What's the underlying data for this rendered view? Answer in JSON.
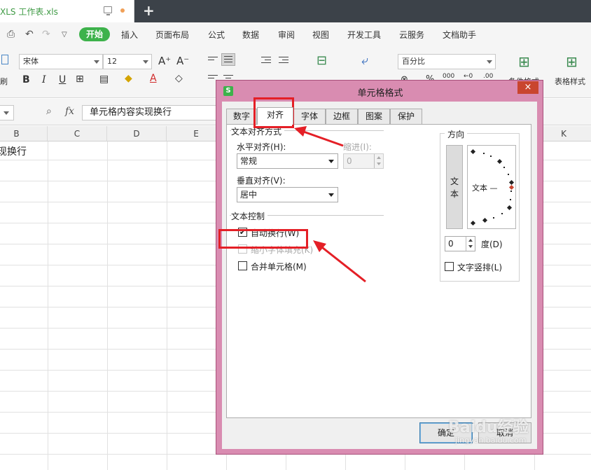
{
  "titlebar": {
    "doc_title": "XLS 工作表.xls",
    "new_tab": "+"
  },
  "menubar": {
    "items": [
      "开始",
      "插入",
      "页面布局",
      "公式",
      "数据",
      "审阅",
      "视图",
      "开发工具",
      "云服务",
      "文档助手"
    ]
  },
  "ribbon": {
    "font_name": "宋体",
    "font_size": "12",
    "number_format": "百分比",
    "grow_font": "A⁺",
    "shrink_font": "A⁻",
    "merge_label": "合并居中",
    "wrap_label": "自动换行",
    "cond_format_label": "条件格式",
    "table_style_label": "表格样式",
    "left_edge_label": "刷",
    "percent": "%",
    "thousand": "000",
    "dec_inc": "←0",
    "dec_dec": ".00"
  },
  "formulabar": {
    "fx_icon": "fx",
    "content": "单元格内容实现换行"
  },
  "sheet": {
    "columns": [
      "B",
      "C",
      "D",
      "E",
      "K"
    ],
    "cell_b1": "现换行"
  },
  "dialog": {
    "title": "单元格格式",
    "close": "×",
    "tabs": [
      "数字",
      "对齐",
      "字体",
      "边框",
      "图案",
      "保护"
    ],
    "active_tab": "对齐",
    "text_alignment_section": "文本对齐方式",
    "horizontal_label": "水平对齐(H):",
    "horizontal_value": "常规",
    "indent_label": "缩进(I):",
    "indent_value": "0",
    "vertical_label": "垂直对齐(V):",
    "vertical_value": "居中",
    "text_control_section": "文本控制",
    "wrap_text": {
      "label": "自动换行(W)",
      "checked": true
    },
    "shrink_to_fit": {
      "label": "缩小字体填充(K)",
      "checked": false,
      "disabled": true
    },
    "merge_cells": {
      "label": "合并单元格(M)",
      "checked": false
    },
    "orientation_section": "方向",
    "orientation_vertical_text": "文本",
    "orientation_dial_text": "文本 —",
    "degree_value": "0",
    "degree_label": "度(D)",
    "vertical_text": {
      "label": "文字竖排(L)",
      "checked": false
    },
    "ok": "确定",
    "cancel": "取消"
  },
  "watermark": {
    "brand": "Baidu经验",
    "url": "jingyan.baidu.com"
  },
  "colors": {
    "accent": "#3db24b",
    "dialog_frame": "#d98cb1",
    "highlight": "#e41f26"
  }
}
